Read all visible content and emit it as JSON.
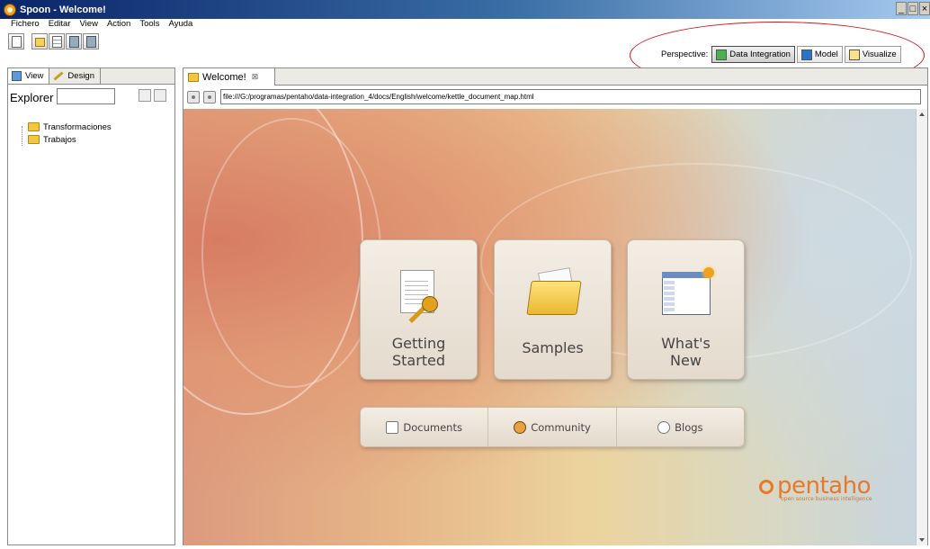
{
  "window": {
    "title": "Spoon - Welcome!",
    "controls": [
      "_",
      "□",
      "×"
    ]
  },
  "menu": [
    "Fichero",
    "Editar",
    "View",
    "Action",
    "Tools",
    "Ayuda"
  ],
  "perspective": {
    "label": "Perspective:",
    "options": [
      {
        "label": "Data Integration",
        "icon": "data-integration-icon",
        "active": true
      },
      {
        "label": "Model",
        "icon": "model-icon",
        "active": false
      },
      {
        "label": "Visualize",
        "icon": "visualize-icon",
        "active": false
      }
    ],
    "highlight_color": "#d01818"
  },
  "left_panel": {
    "tabs": [
      "View",
      "Design"
    ],
    "explorer_label": "Explorer",
    "explorer_value": "",
    "tree": [
      "Transformaciones",
      "Trabajos"
    ]
  },
  "editor": {
    "tab_label": "Welcome!",
    "tab_close": "⊠",
    "url": "file:///G:/programas/pentaho/data-integration_4/docs/English/welcome/kettle_document_map.html"
  },
  "welcome": {
    "cards": [
      {
        "label_line1": "Getting",
        "label_line2": "Started"
      },
      {
        "label_line1": "Samples",
        "label_line2": ""
      },
      {
        "label_line1": "What's",
        "label_line2": "New"
      }
    ],
    "links": [
      "Documents",
      "Community",
      "Blogs"
    ],
    "logo": {
      "brand": "pentaho",
      "tagline": "open source business intelligence"
    }
  },
  "colors": {
    "titlebar": "#0a246a",
    "accent": "#e8782a",
    "highlight": "#d01818"
  }
}
